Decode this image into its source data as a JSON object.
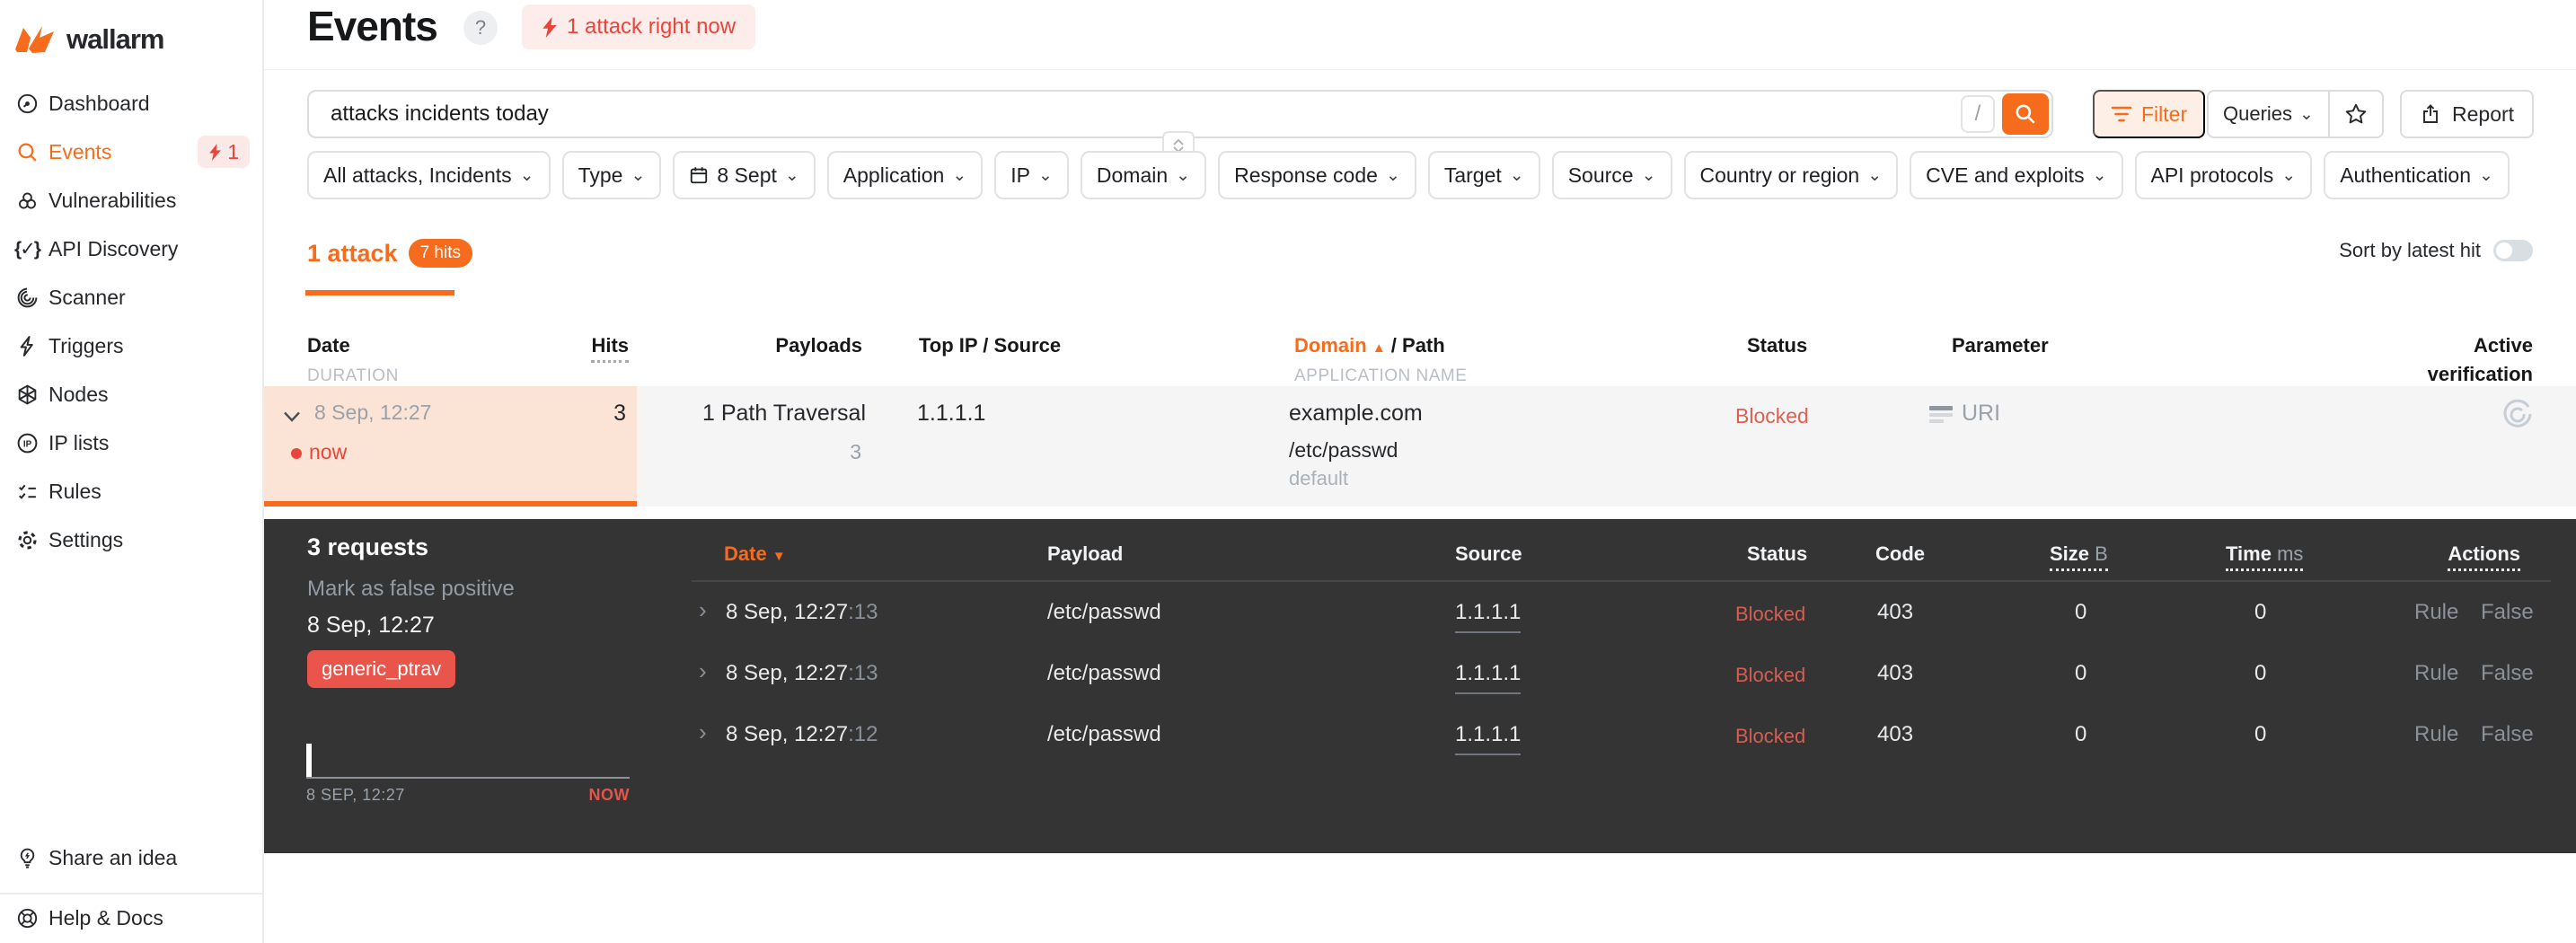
{
  "brand": {
    "name": "wallarm"
  },
  "sidebar": {
    "items": [
      {
        "label": "Dashboard"
      },
      {
        "label": "Events",
        "badge": "1"
      },
      {
        "label": "Vulnerabilities"
      },
      {
        "label": "API Discovery"
      },
      {
        "label": "Scanner"
      },
      {
        "label": "Triggers"
      },
      {
        "label": "Nodes"
      },
      {
        "label": "IP lists"
      },
      {
        "label": "Rules"
      },
      {
        "label": "Settings"
      }
    ],
    "share": "Share an idea",
    "help": "Help & Docs"
  },
  "header": {
    "title": "Events",
    "help_symbol": "?",
    "alert": "1 attack right now"
  },
  "search": {
    "value": "attacks incidents today",
    "shortcut": "/"
  },
  "toolbar": {
    "filter": "Filter",
    "queries": "Queries",
    "report": "Report"
  },
  "filters": {
    "attacks": "All attacks, Incidents",
    "type": "Type",
    "date": "8 Sept",
    "application": "Application",
    "ip": "IP",
    "domain": "Domain",
    "response_code": "Response code",
    "target": "Target",
    "source": "Source",
    "country": "Country or region",
    "cve": "CVE and exploits",
    "api_protocols": "API protocols",
    "authentication": "Authentication"
  },
  "summary": {
    "attacks": "1 attack",
    "hits": "7 hits",
    "sort": "Sort by latest hit"
  },
  "table": {
    "headers": {
      "date": "Date",
      "duration": "DURATION",
      "hits": "Hits",
      "payloads": "Payloads",
      "top_ip": "Top IP / Source",
      "domain": "Domain",
      "path": "/ Path",
      "application": "APPLICATION NAME",
      "status": "Status",
      "parameter": "Parameter",
      "verification_line1": "Active",
      "verification_line2": "verification"
    },
    "row": {
      "date": "8 Sep, 12:27",
      "duration": "now",
      "hits": "3",
      "payload": "1 Path Traversal",
      "payload_count": "3",
      "top_ip": "1.1.1.1",
      "domain": "example.com",
      "path": "/etc/passwd",
      "application": "default",
      "status": "Blocked",
      "parameter": "URI"
    }
  },
  "details": {
    "title": "3 requests",
    "false_positive": "Mark as false positive",
    "timestamp": "8 Sep, 12:27",
    "tag": "generic_ptrav",
    "chart_data": {
      "type": "bar",
      "values": [
        3
      ],
      "x_start_label": "8 SEP, 12:27",
      "x_end_label": "NOW"
    },
    "headers": {
      "date": "Date",
      "payload": "Payload",
      "source": "Source",
      "status": "Status",
      "code": "Code",
      "size": "Size",
      "size_unit": "B",
      "time": "Time",
      "time_unit": "ms",
      "actions": "Actions"
    },
    "rows": [
      {
        "date": "8 Sep, 12:27",
        "seconds": ":13",
        "payload": "/etc/passwd",
        "source": "1.1.1.1",
        "status": "Blocked",
        "code": "403",
        "size": "0",
        "time": "0",
        "rule": "Rule",
        "false_positive": "False"
      },
      {
        "date": "8 Sep, 12:27",
        "seconds": ":13",
        "payload": "/etc/passwd",
        "source": "1.1.1.1",
        "status": "Blocked",
        "code": "403",
        "size": "0",
        "time": "0",
        "rule": "Rule",
        "false_positive": "False"
      },
      {
        "date": "8 Sep, 12:27",
        "seconds": ":12",
        "payload": "/etc/passwd",
        "source": "1.1.1.1",
        "status": "Blocked",
        "code": "403",
        "size": "0",
        "time": "0",
        "rule": "Rule",
        "false_positive": "False"
      }
    ]
  },
  "colors": {
    "accent": "#F76B1C",
    "danger": "#E8453C",
    "blocked": "#DC6150",
    "panel": "#343434"
  }
}
